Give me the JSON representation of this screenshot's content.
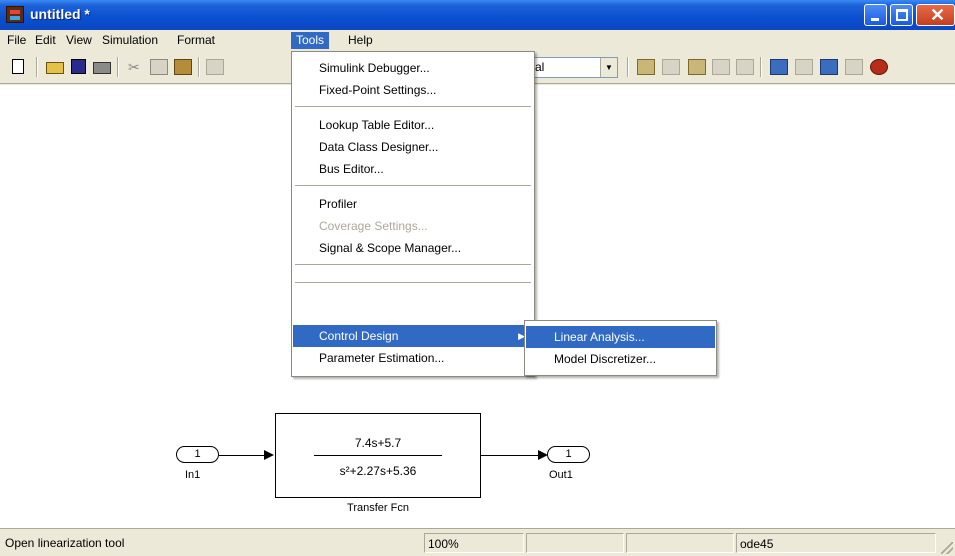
{
  "window": {
    "title": "untitled *"
  },
  "menubar": {
    "items": [
      "File",
      "Edit",
      "View",
      "Simulation",
      "Format",
      "Tools",
      "Help"
    ],
    "active": "Tools"
  },
  "toolbar": {
    "sim_mode_value": "al"
  },
  "tools_menu": {
    "items": [
      "Simulink Debugger...",
      "Fixed-Point Settings...",
      "Lookup Table Editor...",
      "Data Class Designer...",
      "Bus Editor...",
      "Profiler",
      "Coverage Settings...",
      "Signal & Scope Manager...",
      "Control Design",
      "Parameter Estimation..."
    ],
    "disabled": [
      "Coverage Settings..."
    ],
    "highlighted": "Control Design"
  },
  "control_design_submenu": {
    "items": [
      "Linear Analysis...",
      "Model Discretizer..."
    ],
    "highlighted": "Linear Analysis..."
  },
  "diagram": {
    "inport": {
      "number": "1",
      "label": "In1"
    },
    "outport": {
      "number": "1",
      "label": "Out1"
    },
    "transfer_fcn": {
      "numerator": "7.4s+5.7",
      "denominator": "s²+2.27s+5.36",
      "label": "Transfer Fcn"
    }
  },
  "statusbar": {
    "message": "Open linearization tool",
    "zoom": "100%",
    "solver": "ode45"
  },
  "colors": {
    "titlebar": "#0a4fd1",
    "highlight": "#316ac5",
    "chrome": "#ece9d8"
  }
}
